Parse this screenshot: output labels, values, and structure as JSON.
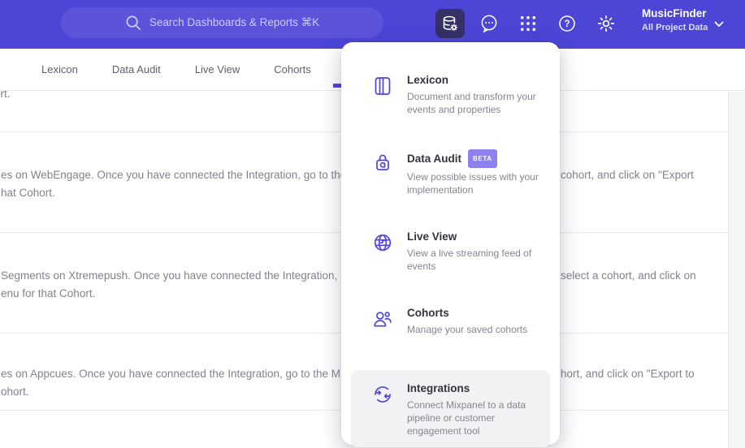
{
  "topbar": {
    "search_placeholder": "Search Dashboards & Reports ⌘K",
    "project_name": "MusicFinder",
    "project_scope": "All Project Data",
    "help_glyph": "?"
  },
  "tabs": [
    "Lexicon",
    "Data Audit",
    "Live View",
    "Cohorts"
  ],
  "menu": {
    "items": [
      {
        "title": "Lexicon",
        "desc": "Document and transform your events and properties",
        "icon": "book-icon"
      },
      {
        "title": "Data Audit",
        "badge": "BETA",
        "desc": "View possible issues with your implementation",
        "icon": "lock-icon"
      },
      {
        "title": "Live View",
        "desc": "View a live streaming feed of events",
        "icon": "globe-icon"
      },
      {
        "title": "Cohorts",
        "desc": "Manage your saved cohorts",
        "icon": "people-icon"
      },
      {
        "title": "Integrations",
        "desc": "Connect Mixpanel to a data pipeline or customer engagement tool",
        "icon": "sync-icon"
      }
    ]
  },
  "content": {
    "rows": [
      {
        "tail": "ort."
      },
      {
        "line1_left": "es on WebEngage. Once you have connected the Integration, go to the",
        "line1_right": "cohort, and click on \"Export",
        "line2": "hat Cohort."
      },
      {
        "line1_left": "Segments on Xtremepush. Once you have connected the Integration,",
        "line1_right": "select a cohort, and click on",
        "line2": "enu for that Cohort."
      },
      {
        "line1_left": "es on Appcues. Once you have connected the Integration, go to the M",
        "line1_right": "hort, and click on \"Export to",
        "line2": "ohort."
      }
    ]
  },
  "colors": {
    "topbar": "#4c45d6",
    "pill": "#5b54da",
    "tile": "#353066",
    "accent": "#4f44e0",
    "badge": "#8f80f0",
    "title": "#33333e",
    "desc": "#85858e",
    "divider": "#e9e9ec",
    "highlight": "#f2f2f4",
    "gutter": "#f5f5f7"
  }
}
